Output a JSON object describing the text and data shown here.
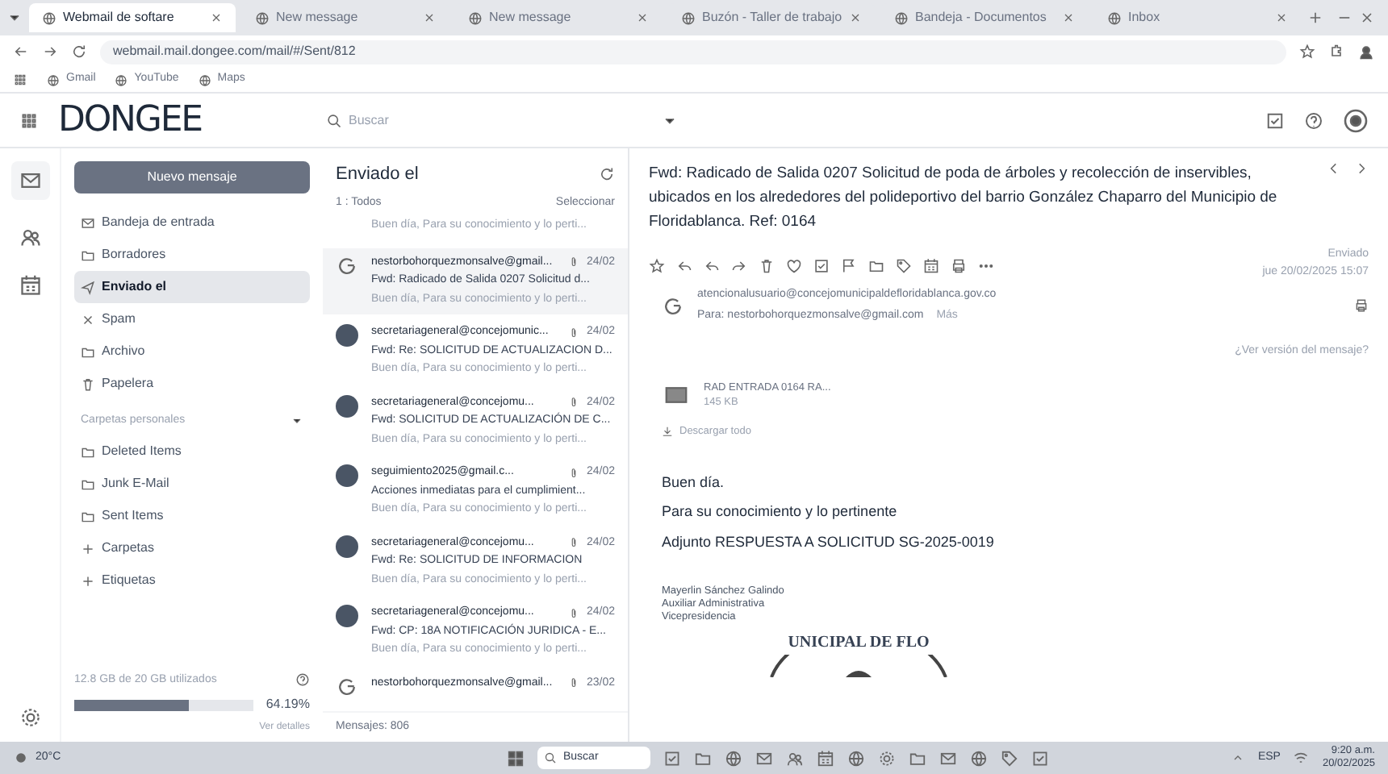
{
  "browser": {
    "tabs": [
      {
        "title": "Webmail de softare",
        "selected": true
      },
      {
        "title": "New message",
        "selected": false
      },
      {
        "title": "New message",
        "selected": false
      },
      {
        "title": "Buzón - Taller de trabajo",
        "selected": false
      },
      {
        "title": "Bandeja - Documentos",
        "selected": false
      },
      {
        "title": "Inbox",
        "selected": false
      }
    ],
    "url": "webmail.mail.dongee.com/mail/#/Sent/812",
    "bookmarks": [
      "Gmail",
      "YouTube",
      "Maps"
    ]
  },
  "app": {
    "logo": "DONGEE",
    "search_placeholder": "Buscar",
    "compose": "Nuevo mensaje",
    "folders": [
      {
        "label": "Bandeja de entrada",
        "selected": false
      },
      {
        "label": "Borradores",
        "selected": false
      },
      {
        "label": "Enviado el",
        "selected": true
      },
      {
        "label": "Spam",
        "selected": false
      },
      {
        "label": "Archivo",
        "selected": false
      },
      {
        "label": "Papelera",
        "selected": false
      }
    ],
    "section": "Carpetas personales",
    "personal_folders": [
      "Deleted Items",
      "Junk E-Mail",
      "Sent Items"
    ],
    "add_links": [
      "Carpetas",
      "Etiquetas"
    ],
    "storage": {
      "label": "12.8 GB de 20 GB utilizados",
      "percent": "64.19%",
      "level": 0.64,
      "link": "Ver detalles"
    }
  },
  "list": {
    "title": "Enviado el",
    "filter": "1 : Todos",
    "select": "Seleccionar",
    "partial_preview": "Buen día, Para su conocimiento y lo perti...",
    "messages": [
      {
        "kind": "logo",
        "sender": "nestorbohorquezmonsalve@gmail...",
        "date": "24/02",
        "subject": "Fwd: Radicado de Salida 0207 Solicitud d...",
        "preview": "Buen día, Para su conocimiento y lo perti...",
        "selected": true
      },
      {
        "kind": "avatar",
        "sender": "secretariageneral@concejomunic...",
        "date": "24/02",
        "subject": "Fwd: Re: SOLICITUD DE ACTUALIZACION D...",
        "preview": "Buen día, Para su conocimiento y lo perti...",
        "selected": false
      },
      {
        "kind": "avatar",
        "sender": "secretariageneral@concejomu...",
        "date": "24/02",
        "subject": "Fwd: SOLICITUD DE ACTUALIZACIÓN DE C...",
        "preview": "Buen día, Para su conocimiento y lo perti...",
        "selected": false
      },
      {
        "kind": "avatar",
        "sender": "seguimiento2025@gmail.c...",
        "date": "24/02",
        "subject": "Acciones inmediatas para el cumplimient...",
        "preview": "Buen día, Para su conocimiento y lo perti...",
        "selected": false
      },
      {
        "kind": "avatar",
        "sender": "secretariageneral@concejomu...",
        "date": "24/02",
        "subject": "Fwd: Re: SOLICITUD DE INFORMACION",
        "preview": "Buen día, Para su conocimiento y lo perti...",
        "selected": false
      },
      {
        "kind": "avatar",
        "sender": "secretariageneral@concejomu...",
        "date": "24/02",
        "subject": "Fwd: CP: 18A NOTIFICACIÓN JURIDICA - E...",
        "preview": "Buen día, Para su conocimiento y lo perti...",
        "selected": false
      },
      {
        "kind": "logo",
        "sender": "nestorbohorquezmonsalve@gmail...",
        "date": "23/02",
        "selected": false
      }
    ],
    "count": "Mensajes: 806"
  },
  "message": {
    "subject": "Fwd: Radicado de Salida 0207 Solicitud de poda de árboles y recolección de inservibles, ubicados en los alrededores del polideportivo del barrio González Chaparro del Municipio de Floridablanca. Ref: 0164",
    "sent_label": "Enviado",
    "date": "jue 20/02/2025 15:07",
    "from": "atencionalusuario@concejomunicipaldefloridablanca.gov.co",
    "to": "Para: nestorbohorquezmonsalve@gmail.com",
    "to_more": "Más",
    "version_link": "¿Ver versión del mensaje?",
    "attachment": {
      "name": "RAD ENTRADA 0164 RA...",
      "size": "145 KB"
    },
    "download_all": "Descargar todo",
    "body": [
      "Buen día.",
      "Para su conocimiento y lo pertinente",
      "Adjunto RESPUESTA A SOLICITUD SG-2025-0019"
    ],
    "signature": [
      "Mayerlin Sánchez Galindo",
      "Auxiliar Administrativa",
      "Vicepresidencia"
    ],
    "seal_text": "UNICIPAL DE FLO"
  },
  "taskbar": {
    "weather": "20°C",
    "search": "Buscar",
    "lang": "ESP",
    "time": "9:20 a.m.",
    "date": "20/02/2025"
  }
}
